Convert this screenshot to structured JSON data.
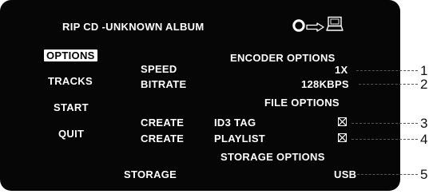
{
  "header": {
    "title": "RIP CD -UNKNOWN ALBUM"
  },
  "menu": {
    "items": [
      {
        "label": "OPTIONS",
        "selected": true
      },
      {
        "label": "TRACKS",
        "selected": false
      },
      {
        "label": "START",
        "selected": false
      },
      {
        "label": "QUIT",
        "selected": false
      }
    ]
  },
  "encoder": {
    "heading": "ENCODER OPTIONS",
    "speed_label": "SPEED",
    "speed_value": "1X",
    "bitrate_label": "BITRATE",
    "bitrate_value": "128KBPS"
  },
  "file": {
    "heading": "FILE  OPTIONS",
    "id3_create": "CREATE",
    "id3_label": "ID3   TAG",
    "id3_checked": true,
    "playlist_create": "CREATE",
    "playlist_label": "PLAYLIST",
    "playlist_checked": true
  },
  "storage": {
    "heading": "STORAGE   OPTIONS",
    "label": "STORAGE",
    "value": "USB"
  },
  "callouts": [
    "1",
    "2",
    "3",
    "4",
    "5"
  ],
  "icons": [
    "disc-icon",
    "arrow-right-icon",
    "device-icon",
    "checkbox-checked-icon"
  ],
  "colors": {
    "screen": "#060606",
    "text": "#ffffff",
    "highlight": "#ffffff",
    "leader": "#555555"
  }
}
